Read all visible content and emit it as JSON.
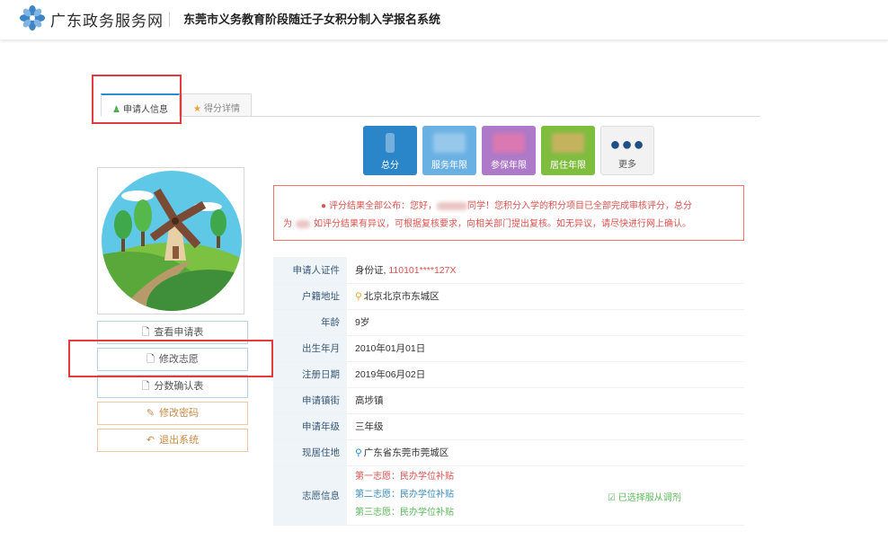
{
  "header": {
    "site_name": "广东政务服务网",
    "system_title": "东莞市义务教育阶段随迁子女积分制入学报名系统",
    "logo_icon": "flower-logo-icon"
  },
  "tabs": [
    {
      "label": "申请人信息",
      "icon": "user-icon",
      "active": true
    },
    {
      "label": "得分详情",
      "icon": "star-icon",
      "active": false
    }
  ],
  "score_tiles": [
    {
      "label": "总分",
      "color": "#2a86c8"
    },
    {
      "label": "服务年限",
      "color": "#6ab1e3"
    },
    {
      "label": "参保年限",
      "color": "#ad79c8"
    },
    {
      "label": "居住年限",
      "color": "#7fbd3f"
    },
    {
      "label": "更多",
      "color": "#f2f2f2"
    }
  ],
  "notice": {
    "part1": "评分结果全部公布：您好，",
    "part2": "同学！您积分入学的积分项目已全部完成审核评分，总分",
    "part3": "为",
    "part4": "如评分结果有异议，可根据复核要求，向相关部门提出复核。如无异议，请尽快进行网上确认。"
  },
  "side_buttons": [
    {
      "label": "查看申请表",
      "icon": "document-icon"
    },
    {
      "label": "修改志愿",
      "icon": "document-icon"
    },
    {
      "label": "分数确认表",
      "icon": "document-icon"
    },
    {
      "label": "修改密码",
      "icon": "edit-icon"
    },
    {
      "label": "退出系统",
      "icon": "reply-icon"
    }
  ],
  "info": {
    "id_label": "申请人证件",
    "id_type": "身份证,",
    "id_number": "110101****127X",
    "hukou_label": "户籍地址",
    "hukou_value": "北京北京市东城区",
    "age_label": "年龄",
    "age_value": "9岁",
    "birth_label": "出生年月",
    "birth_value": "2010年01月01日",
    "reg_label": "注册日期",
    "reg_value": "2019年06月02日",
    "town_label": "申请镇街",
    "town_value": "高埗镇",
    "grade_label": "申请年级",
    "grade_value": "三年级",
    "residence_label": "现居住地",
    "residence_value": "广东省东莞市莞城区",
    "wish_label": "志愿信息",
    "wishes": [
      "第一志愿：民办学位补贴",
      "第二志愿：民办学位补贴",
      "第三志愿：民办学位补贴"
    ],
    "accept_transfer": "已选择服从调剂"
  },
  "colors": {
    "accent_blue": "#2b8ecf",
    "notice_red": "#d9534f",
    "highlight_box": "#e23b3b"
  }
}
